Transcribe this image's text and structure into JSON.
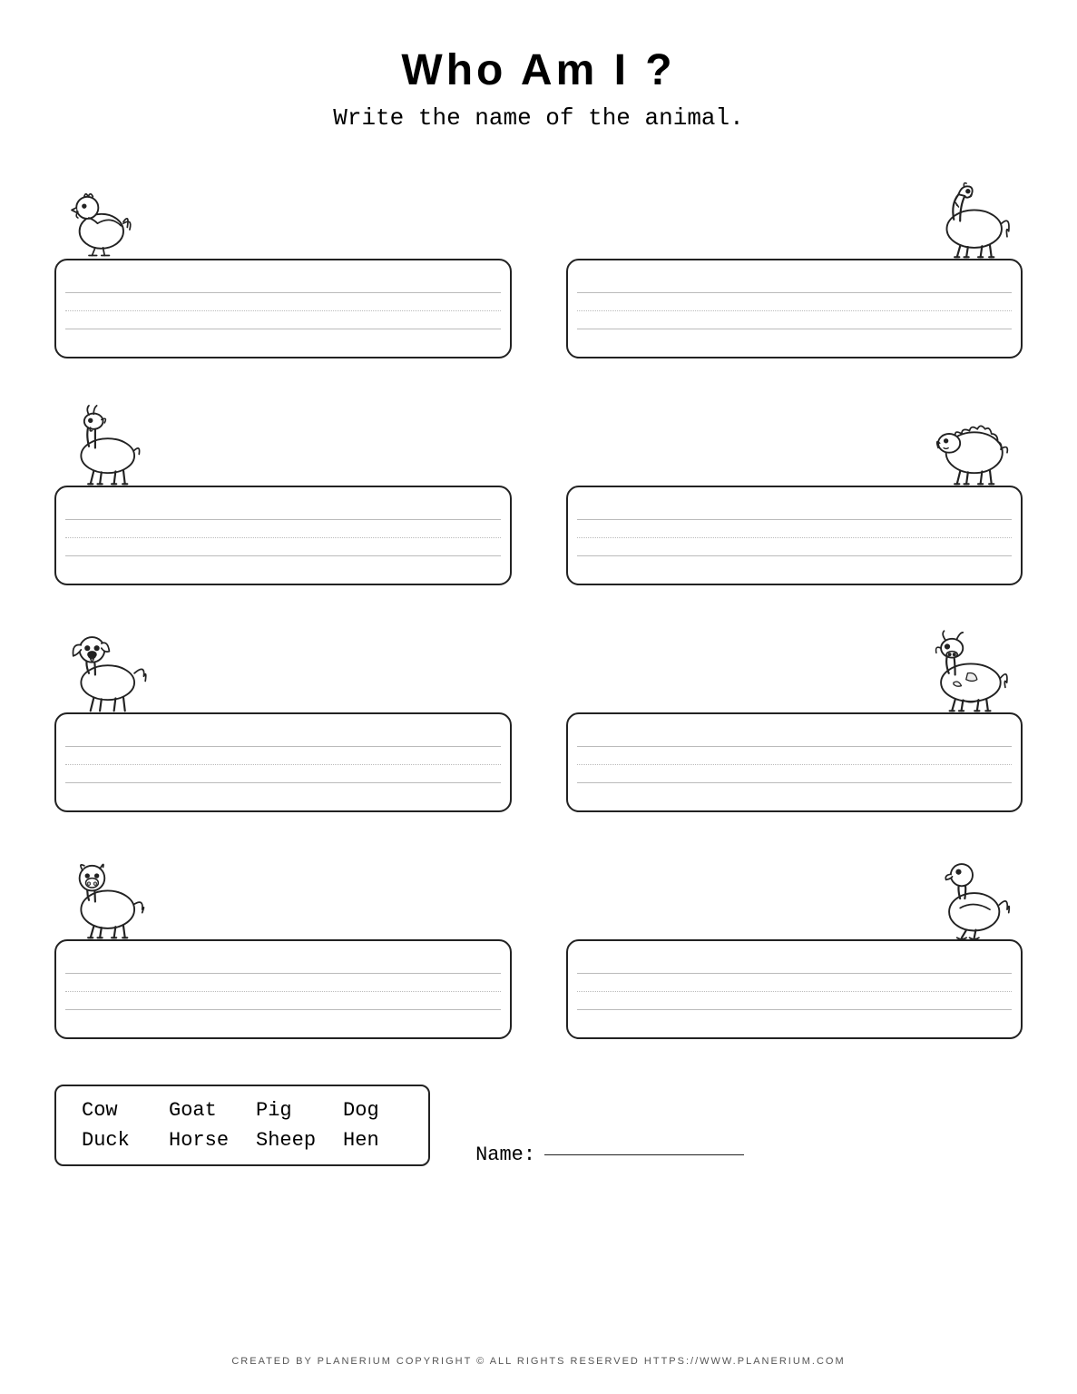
{
  "title": "Who Am I ?",
  "subtitle": "Write the name of the animal.",
  "animals": [
    {
      "name": "Hen",
      "position": "left"
    },
    {
      "name": "Horse",
      "position": "right"
    },
    {
      "name": "Goat",
      "position": "left"
    },
    {
      "name": "Sheep",
      "position": "right"
    },
    {
      "name": "Dog",
      "position": "left"
    },
    {
      "name": "Cow",
      "position": "right"
    },
    {
      "name": "Pig",
      "position": "left"
    },
    {
      "name": "Duck",
      "position": "right"
    }
  ],
  "word_bank": {
    "words": [
      "Cow",
      "Goat",
      "Pig",
      "Dog",
      "Duck",
      "Horse",
      "Sheep",
      "Hen"
    ]
  },
  "name_label": "Name:",
  "footer": "CREATED BY PLANERIUM COPYRIGHT © ALL RIGHTS RESERVED   HTTPS://WWW.PLANERIUM.COM"
}
